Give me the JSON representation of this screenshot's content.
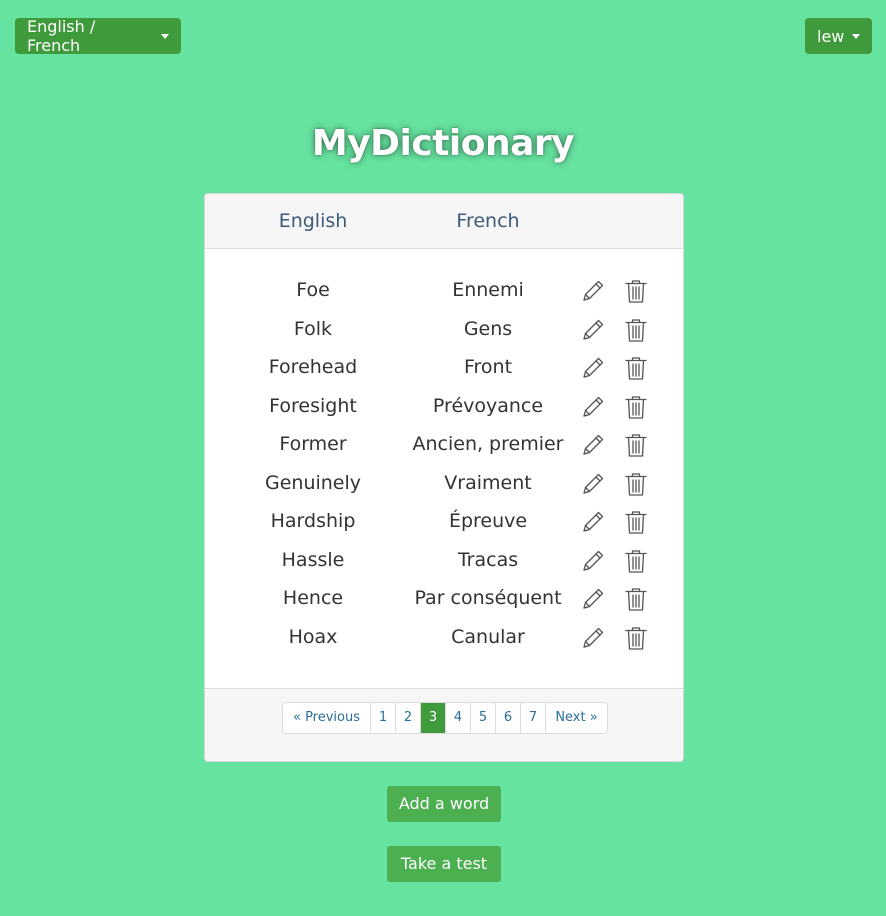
{
  "header": {
    "language_pair": "English / French",
    "user_menu": "lew"
  },
  "app": {
    "title": "MyDictionary"
  },
  "table": {
    "columns": [
      "English",
      "French"
    ],
    "rows": [
      {
        "english": "Foe",
        "french": "Ennemi"
      },
      {
        "english": "Folk",
        "french": "Gens"
      },
      {
        "english": "Forehead",
        "french": "Front"
      },
      {
        "english": "Foresight",
        "french": "Prévoyance"
      },
      {
        "english": "Former",
        "french": "Ancien, premier"
      },
      {
        "english": "Genuinely",
        "french": "Vraiment"
      },
      {
        "english": "Hardship",
        "french": "Épreuve"
      },
      {
        "english": "Hassle",
        "french": "Tracas"
      },
      {
        "english": "Hence",
        "french": "Par conséquent"
      },
      {
        "english": "Hoax",
        "french": "Canular"
      }
    ],
    "row_icons": [
      "pencil-icon",
      "trash-icon"
    ]
  },
  "pagination": {
    "prev_label": "« Previous",
    "next_label": "Next »",
    "pages": [
      "1",
      "2",
      "3",
      "4",
      "5",
      "6",
      "7"
    ],
    "current_page": "3"
  },
  "actions": {
    "add_word": "Add a word",
    "take_test": "Take a test"
  },
  "colors": {
    "background": "#66e3a0",
    "dropdown": "#3e9a3a",
    "action_button": "#4caf50",
    "active_page": "#3e9a3a",
    "link": "#2a6e99"
  }
}
